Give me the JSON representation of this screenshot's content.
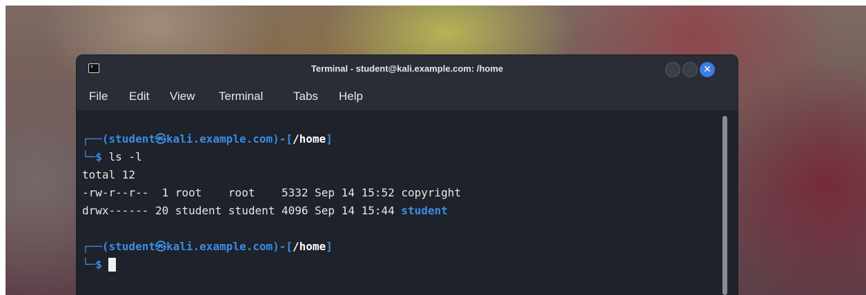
{
  "window": {
    "title": "Terminal - student@kali.example.com: /home",
    "close_glyph": "✕"
  },
  "menu": [
    "File",
    "Edit",
    "View",
    "Terminal",
    "Tabs",
    "Help"
  ],
  "terminal": {
    "prompt1": {
      "box_top": "┌──(",
      "user": "student",
      "at_glyph": "㉿",
      "host": "kali.example.com",
      "mid": ")-[",
      "path": "/home",
      "end": "]",
      "box_bottom": "└─",
      "dollar": "$",
      "command": " ls -l"
    },
    "output": [
      "total 12",
      "-rw-r--r--  1 root    root    5332 Sep 14 15:52 copyright",
      "drwx------ 20 student student 4096 Sep 14 15:44 "
    ],
    "dir_name": "student",
    "prompt2": {
      "box_top": "┌──(",
      "user": "student",
      "at_glyph": "㉿",
      "host": "kali.example.com",
      "mid": ")-[",
      "path": "/home",
      "end": "]",
      "box_bottom": "└─",
      "dollar": "$"
    }
  },
  "colors": {
    "prompt_blue": "#3a8ce6",
    "close_button": "#3a7ee8",
    "terminal_bg": "#1e222a"
  }
}
